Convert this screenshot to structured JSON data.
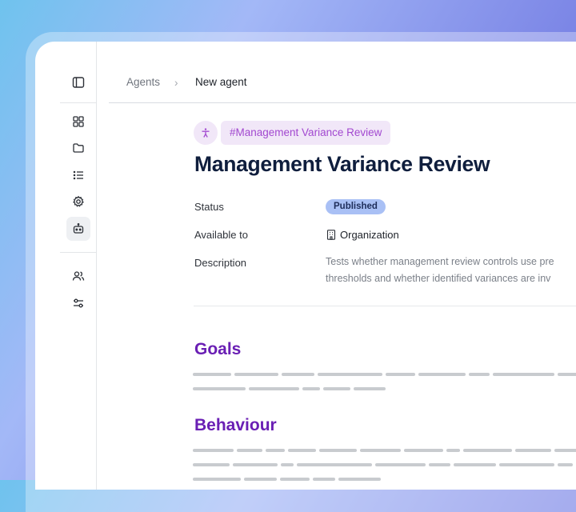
{
  "sidebar": {
    "icons": [
      "panel-toggle-icon",
      "dashboard-icon",
      "folder-icon",
      "list-icon",
      "settings-icon",
      "agent-icon",
      "users-icon",
      "sliders-icon"
    ],
    "active": "agent-icon"
  },
  "breadcrumb": {
    "root": "Agents",
    "separator": "›",
    "current": "New agent"
  },
  "agent": {
    "tag": "#Management Variance Review",
    "title": "Management Variance Review",
    "status_label": "Status",
    "status_value": "Published",
    "available_label": "Available to",
    "available_value": "Organization",
    "description_label": "Description",
    "description_line1": "Tests whether management review controls use pre",
    "description_line2": "thresholds and whether identified variances are inv"
  },
  "sections": {
    "goals": "Goals",
    "behaviour": "Behaviour"
  },
  "colors": {
    "accent": "#6a1fb4",
    "tag_text": "#a248d0",
    "badge_bg": "#a9c0f5",
    "title": "#0f1e3d"
  }
}
